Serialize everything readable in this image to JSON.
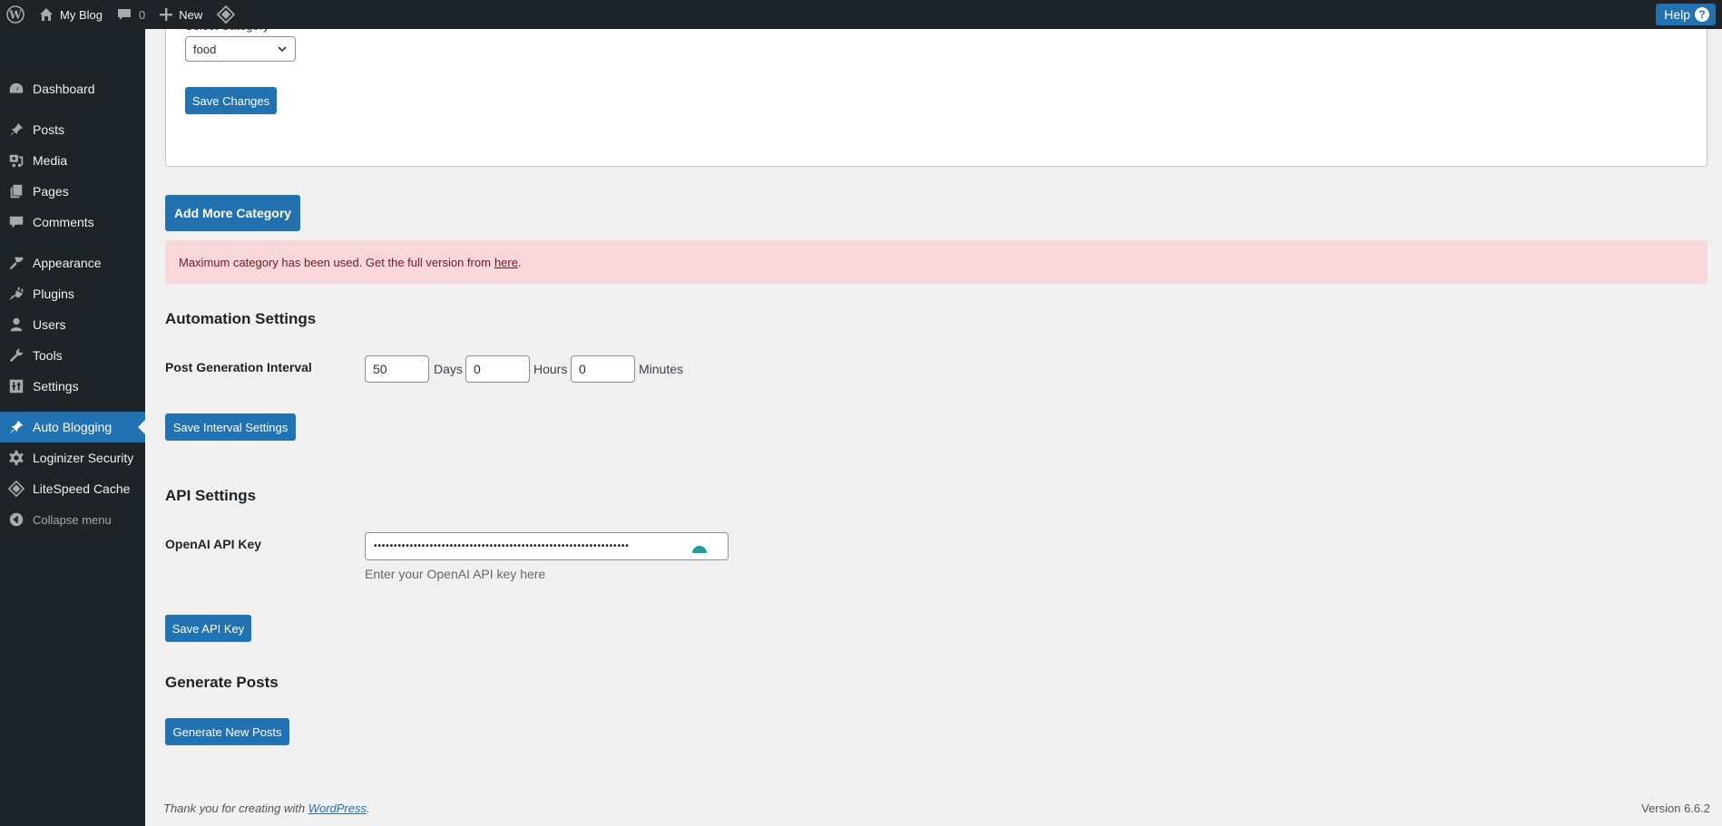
{
  "adminbar": {
    "site_name": "My Blog",
    "comments_count": "0",
    "new_label": "New",
    "help_label": "Help",
    "help_icon": "?"
  },
  "sidebar": {
    "items": [
      {
        "label": "Dashboard",
        "icon": "dashboard-icon"
      },
      {
        "label": "Posts",
        "icon": "pin-icon"
      },
      {
        "label": "Media",
        "icon": "media-icon"
      },
      {
        "label": "Pages",
        "icon": "pages-icon"
      },
      {
        "label": "Comments",
        "icon": "comment-icon"
      },
      {
        "label": "Appearance",
        "icon": "paintbrush-icon"
      },
      {
        "label": "Plugins",
        "icon": "plugin-icon"
      },
      {
        "label": "Users",
        "icon": "user-icon"
      },
      {
        "label": "Tools",
        "icon": "wrench-icon"
      },
      {
        "label": "Settings",
        "icon": "settings-icon"
      },
      {
        "label": "Auto Blogging",
        "icon": "pin-icon",
        "active": true
      },
      {
        "label": "Loginizer Security",
        "icon": "gear-icon"
      },
      {
        "label": "LiteSpeed Cache",
        "icon": "litespeed-icon"
      },
      {
        "label": "Collapse menu",
        "icon": "collapse-icon"
      }
    ]
  },
  "category": {
    "label": "Select Category",
    "selected": "food",
    "save_label": "Save Changes"
  },
  "add_category_label": "Add More Category",
  "notice": {
    "text": "Maximum category has been used. Get the full version from",
    "link": "here",
    "suffix": "."
  },
  "automation": {
    "heading": "Automation Settings",
    "interval_label": "Post Generation Interval",
    "days": "50",
    "days_unit": "Days",
    "hours": "0",
    "hours_unit": "Hours",
    "minutes": "0",
    "minutes_unit": "Minutes",
    "save_label": "Save Interval Settings"
  },
  "api": {
    "heading": "API Settings",
    "key_label": "OpenAI API Key",
    "key_masked": "••••••••••••••••••••••••••••••••••••••••••••••••••••••••••••••••",
    "description": "Enter your OpenAI API key here",
    "save_label": "Save API Key"
  },
  "generate": {
    "heading": "Generate Posts",
    "button_label": "Generate New Posts"
  },
  "footer": {
    "thanks": "Thank you for creating with",
    "link": "WordPress",
    "suffix": ".",
    "version": "Version 6.6.2"
  },
  "colors": {
    "accent": "#2271b1",
    "adminbar_bg": "#1d2327",
    "notice_bg": "#f8d7da",
    "notice_text": "#721c24"
  }
}
